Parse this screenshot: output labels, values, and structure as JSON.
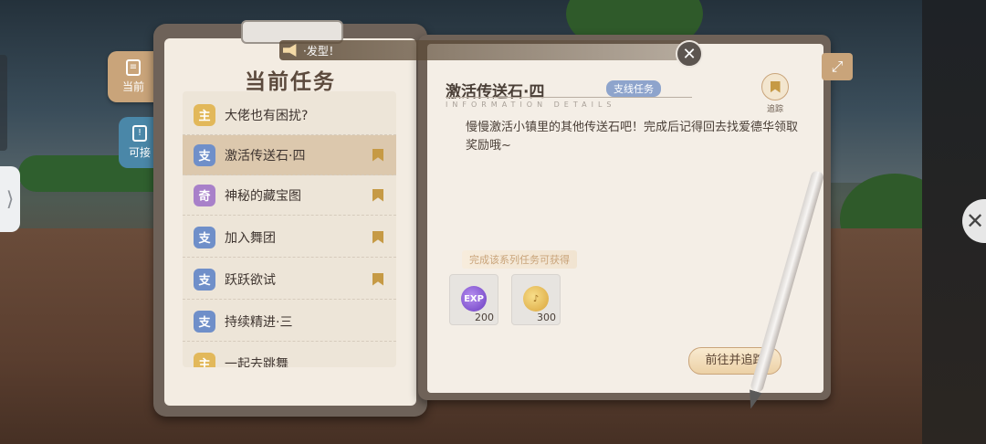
{
  "announcement": {
    "text": "·发型！"
  },
  "tabs": [
    {
      "label": "当前",
      "icon": "notepad-icon"
    },
    {
      "label": "可接",
      "icon": "exclamation-icon"
    }
  ],
  "quest_panel": {
    "title": "当前任务",
    "quests": [
      {
        "type": "主",
        "name": "大佬也有困扰?",
        "tracked": false
      },
      {
        "type": "支",
        "name": "激活传送石·四",
        "tracked": true,
        "selected": true
      },
      {
        "type": "奇",
        "name": "神秘的藏宝图",
        "tracked": true
      },
      {
        "type": "支",
        "name": "加入舞团",
        "tracked": true
      },
      {
        "type": "支",
        "name": "跃跃欲试",
        "tracked": true
      },
      {
        "type": "支",
        "name": "持续精进·三",
        "tracked": false
      },
      {
        "type": "主",
        "name": "一起去跳舞",
        "tracked": false
      }
    ]
  },
  "detail": {
    "title": "激活传送石·四",
    "tag": "支线任务",
    "subtitle": "INFORMATION DETAILS",
    "track_label": "追踪",
    "description": "慢慢激活小镇里的其他传送石吧！完成后记得回去找爱德华领取奖励哦~",
    "reward_caption": "完成该系列任务可获得",
    "rewards": [
      {
        "icon": "exp-icon",
        "label": "EXP",
        "amount": "200"
      },
      {
        "icon": "coin-icon",
        "label": "♪",
        "amount": "300"
      }
    ],
    "go_button": "前往并追踪"
  },
  "colors": {
    "accent": "#c9a47a",
    "main_badge": "#e2b85a",
    "branch_badge": "#6f8fc9",
    "mystery_badge": "#a880c9"
  }
}
